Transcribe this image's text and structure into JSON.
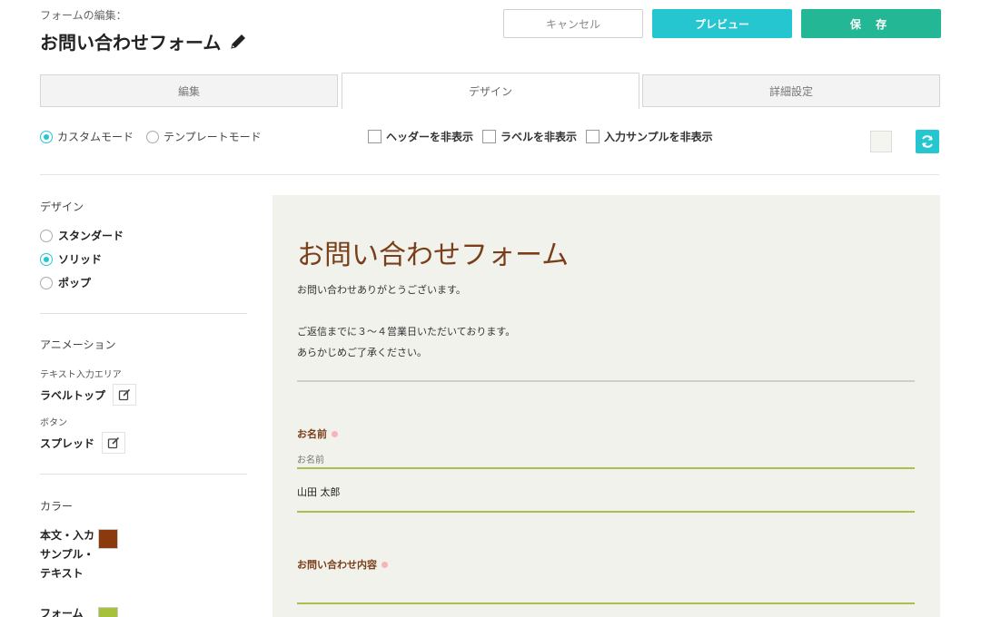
{
  "header": {
    "form_edit_label": "フォームの編集：",
    "form_title": "お問い合わせフォーム",
    "cancel_label": "キャンセル",
    "preview_label": "プレビュー",
    "save_label": "保 存"
  },
  "tabs": [
    {
      "label": "編集",
      "active": false
    },
    {
      "label": "デザイン",
      "active": true
    },
    {
      "label": "詳細設定",
      "active": false
    }
  ],
  "mode": {
    "custom_label": "カスタムモード",
    "template_label": "テンプレートモード",
    "selected": "custom"
  },
  "toggles": {
    "hide_header": "ヘッダーを非表示",
    "hide_labels": "ラベルを非表示",
    "hide_samples": "入力サンプルを非表示"
  },
  "sidebar": {
    "design_heading": "デザイン",
    "design_options": [
      {
        "label": "スタンダード",
        "selected": false
      },
      {
        "label": "ソリッド",
        "selected": true
      },
      {
        "label": "ポップ",
        "selected": false
      }
    ],
    "animation_heading": "アニメーション",
    "text_area_label": "テキスト入力エリア",
    "text_area_value": "ラベルトップ",
    "button_label": "ボタン",
    "button_value": "スプレッド",
    "color_heading": "カラー",
    "color_items": [
      {
        "label": "本文・入カサンプル・テキスト",
        "color": "#8b3a0e"
      },
      {
        "label": "フォーム",
        "color": "#a6c13c"
      }
    ]
  },
  "preview": {
    "title": "お問い合わせフォーム",
    "intro_line1": "お問い合わせありがとうございます。",
    "intro_line2": "ご返信までに３〜４営業日いただいております。",
    "intro_line3": "あらかじめご了承ください。",
    "field1_label": "お名前",
    "field1_placeholder": "お名前",
    "field1_value": "山田 太郎",
    "field2_label": "お問い合わせ内容"
  },
  "colors": {
    "accent": "#26c6d1",
    "save": "#23b795",
    "title_brown": "#7a3f1a",
    "form_line": "#a8c050",
    "preview_bg": "#f2f2ec"
  }
}
